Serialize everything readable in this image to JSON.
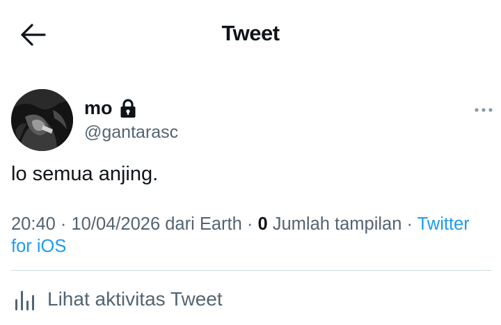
{
  "header": {
    "title": "Tweet",
    "back_icon": "arrow-left-icon"
  },
  "tweet": {
    "author": {
      "display_name": "mo",
      "username": "@gantarasc",
      "protected_icon": "lock-icon"
    },
    "text": "lo semua anjing.",
    "time": "20:40",
    "date": "10/04/2026",
    "location": "dari Earth",
    "views_count": "0",
    "views_label": "Jumlah tampilan",
    "source": "Twitter for iOS",
    "separator": "·"
  },
  "activity": {
    "label": "Lihat aktivitas Tweet",
    "icon": "bar-chart-icon"
  },
  "colors": {
    "text_primary": "#0f1419",
    "text_secondary": "#536471",
    "link": "#1d9bf0",
    "divider": "#cfd9de"
  }
}
